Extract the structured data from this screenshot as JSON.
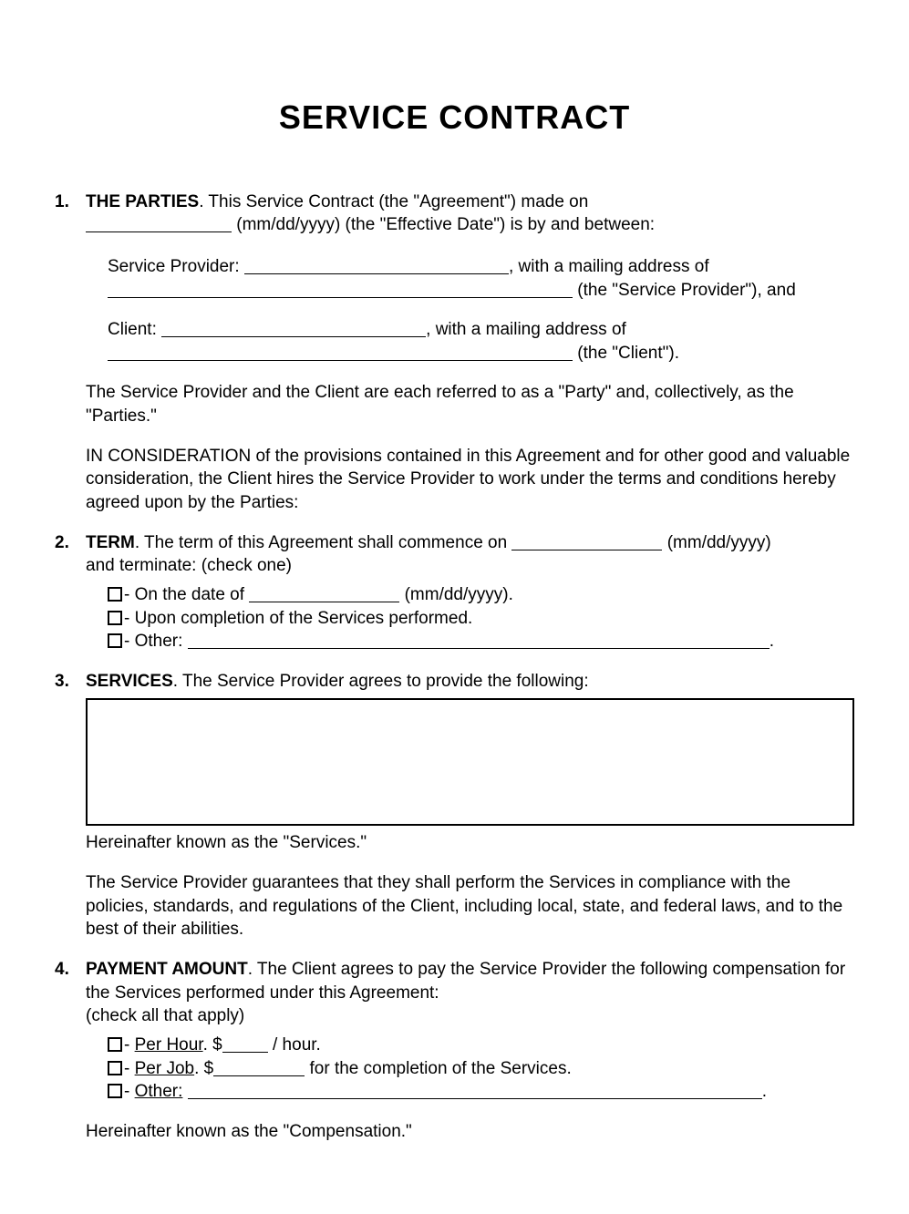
{
  "title": "SERVICE CONTRACT",
  "sections": {
    "s1": {
      "num": "1.",
      "heading": "THE PARTIES",
      "intro1a": ". This Service Contract (the \"Agreement\") made on",
      "intro1b": " (mm/dd/yyyy) (the \"Effective Date\") is by and between:",
      "sp_label": "Service Provider: ",
      "sp_mail": ", with a mailing address of",
      "sp_def": " (the \"Service Provider\"), and",
      "cl_label": "Client: ",
      "cl_mail": ", with a mailing address of",
      "cl_def": " (the \"Client\").",
      "party_def": "The Service Provider and the Client are each referred to as a \"Party\" and, collectively, as the \"Parties.\"",
      "consideration": "IN CONSIDERATION of the provisions contained in this Agreement and for other good and valuable consideration, the Client hires the Service Provider to work under the terms and conditions hereby agreed upon by the Parties:"
    },
    "s2": {
      "num": "2.",
      "heading": "TERM",
      "text1": ". The term of this Agreement shall commence on ",
      "text2": " (mm/dd/yyyy)",
      "text3": "and terminate: (check one)",
      "opt1a": "- On the date of ",
      "opt1b": " (mm/dd/yyyy).",
      "opt2": "- Upon completion of the Services performed.",
      "opt3": "- Other: ",
      "opt3end": "."
    },
    "s3": {
      "num": "3.",
      "heading": "SERVICES",
      "intro": ". The Service Provider agrees to provide the following:",
      "hereinafter": "Hereinafter known as the \"Services.\"",
      "guarantee": "The Service Provider guarantees that they shall perform the Services in compliance with the policies, standards, and regulations of the Client, including local, state, and federal laws, and to the best of their abilities."
    },
    "s4": {
      "num": "4.",
      "heading": "PAYMENT AMOUNT",
      "intro": ". The Client agrees to pay the Service Provider the following compensation for the Services performed under this Agreement:",
      "check": "(check all that apply)",
      "perHourLabel": "Per Hour",
      "perHour_a": ". $",
      "perHour_b": " / hour.",
      "perJobLabel": "Per Job",
      "perJob_a": ". $",
      "perJob_b": " for the completion of the Services.",
      "otherLabel": "Other:",
      "otherEnd": ".",
      "hereinafter": "Hereinafter known as the \"Compensation.\""
    }
  }
}
